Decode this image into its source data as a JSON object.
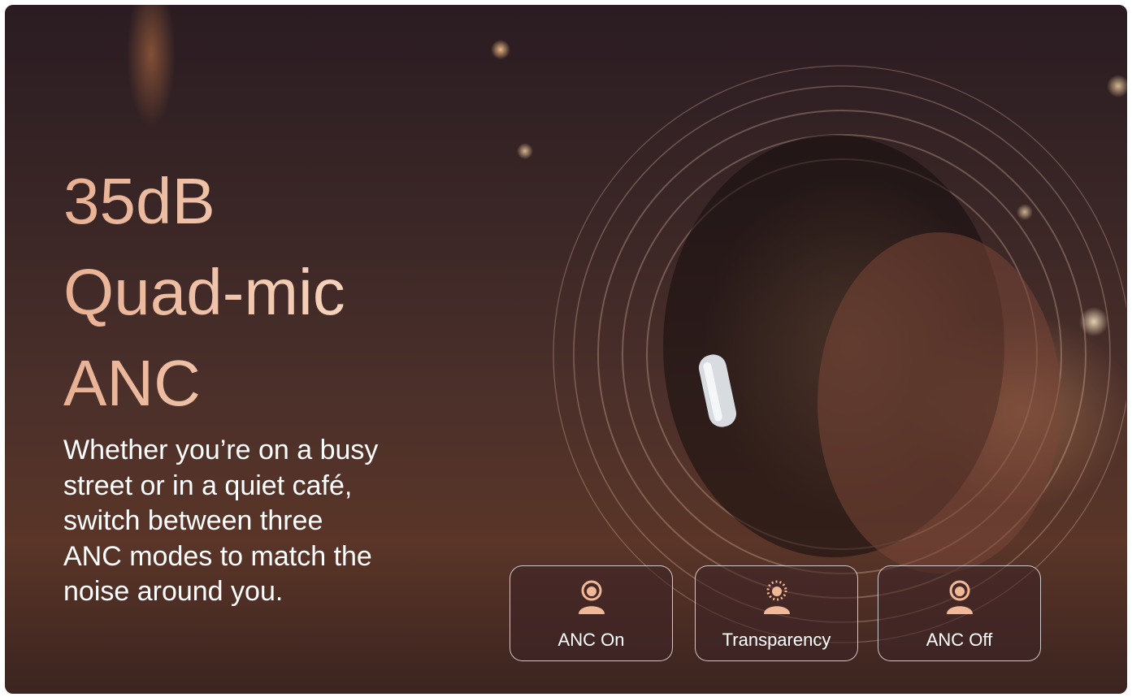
{
  "headline": {
    "line1": "35dB",
    "line2": "Quad-mic",
    "line3": "ANC"
  },
  "description": {
    "line1": "Whether you’re on a busy",
    "line2": "street or in a quiet café,",
    "line3": "switch between three",
    "line4": "ANC modes to match the",
    "line5": "noise around you."
  },
  "modes": [
    {
      "label": "ANC On",
      "icon": "person-ring-icon"
    },
    {
      "label": "Transparency",
      "icon": "person-dotted-ring-icon"
    },
    {
      "label": "ANC Off",
      "icon": "person-ring-icon"
    }
  ],
  "colors": {
    "headline": "#f2c2a2",
    "icon": "#f0b896",
    "text": "#ffffff"
  }
}
